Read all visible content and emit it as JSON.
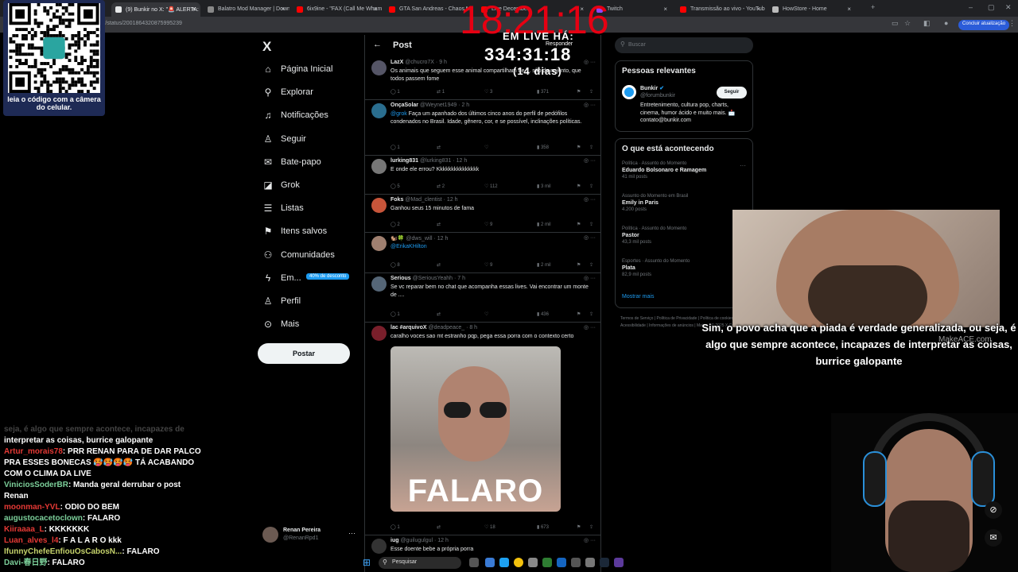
{
  "tabs": [
    {
      "title": "(9) Bunkir no X: \"🚨 ALERTA: E",
      "color": "#e7e9ea",
      "active": true
    },
    {
      "title": "Balatro Mod Manager | Downlo",
      "color": "#888"
    },
    {
      "title": "6ix9ine - \"FAX (Call Me Wham)\"",
      "color": "#ff0000"
    },
    {
      "title": "GTA San Andreas - Chaos M",
      "color": "#ff0000"
    },
    {
      "title": "Live December",
      "color": "#ff0000"
    },
    {
      "title": "Twitch",
      "color": "#9146ff"
    },
    {
      "title": "Transmissão ao vivo - YouTube",
      "color": "#ff0000"
    },
    {
      "title": "HowStore - Home",
      "color": "#bbb"
    }
  ],
  "address": {
    "url": "r/status/2001864320875995239",
    "action_button": "Concluir atualização"
  },
  "qr": {
    "caption": "leia o código com a câmera do celular."
  },
  "overlay": {
    "clock": "18:21:16",
    "live_label": "EM LIVE HÁ:",
    "live_time": "334:31:18",
    "live_days": "(14 dias)"
  },
  "sidebar": {
    "logo": "X",
    "items": [
      {
        "label": "Página Inicial",
        "icon": "home-icon",
        "glyph": "⌂"
      },
      {
        "label": "Explorar",
        "icon": "search-icon",
        "glyph": "⚲"
      },
      {
        "label": "Notificações",
        "icon": "bell-icon",
        "glyph": "♫"
      },
      {
        "label": "Seguir",
        "icon": "follow-icon",
        "glyph": "♙"
      },
      {
        "label": "Bate-papo",
        "icon": "mail-icon",
        "glyph": "✉"
      },
      {
        "label": "Grok",
        "icon": "grok-icon",
        "glyph": "◪"
      },
      {
        "label": "Listas",
        "icon": "list-icon",
        "glyph": "☰"
      },
      {
        "label": "Itens salvos",
        "icon": "bookmark-icon",
        "glyph": "⚑"
      },
      {
        "label": "Comunidades",
        "icon": "people-icon",
        "glyph": "⚇"
      },
      {
        "label": "Em...",
        "icon": "bolt-icon",
        "glyph": "ϟ"
      },
      {
        "label": "Perfil",
        "icon": "person-icon",
        "glyph": "♙"
      },
      {
        "label": "Mais",
        "icon": "more-icon",
        "glyph": "⊙"
      }
    ],
    "promo_badge": "40% de desconto",
    "post_button": "Postar",
    "profile": {
      "name": "Renan Pereira",
      "handle": "@RenanRpd1"
    }
  },
  "feed": {
    "title": "Post",
    "reply_label": "Responder",
    "tweets": [
      {
        "name": "LazX",
        "handle": "@chucro7X · 9 h",
        "text": "Os animais que seguem esse animal compartilham de ... são de nojento, que todos passem fome",
        "replies": "1",
        "reposts": "1",
        "likes": "3",
        "views": "371",
        "avatar": "#556"
      },
      {
        "name": "OnçaSolar",
        "handle": "@Weynet1949 · 2 h",
        "mention": "@grok",
        "text": " Faça um apanhado dos últimos cinco anos do perfil de pedófilos condenados no Brasil. Idade, gênero, cor, e se possível, inclinações políticas.",
        "replies": "1",
        "reposts": "",
        "likes": "",
        "views": "358",
        "avatar": "#2a6e8f"
      },
      {
        "name": "lurking831",
        "handle": "@lurking831 · 12 h",
        "text": "E onde ele errou? Kkkkkkkkkkkkkkk",
        "replies": "5",
        "reposts": "2",
        "likes": "112",
        "views": "3 mil",
        "avatar": "#777"
      },
      {
        "name": "Foks",
        "handle": "@Mad_clentist · 12 h",
        "text": "Ganhou seus 15 minutos de fama",
        "replies": "2",
        "reposts": "",
        "likes": "9",
        "views": "2 mil",
        "avatar": "#c7553a"
      },
      {
        "name": "🐿️🍀",
        "handle": "@dws_will · 12 h",
        "mention": "@ErikaKHilton",
        "text": "",
        "replies": "8",
        "reposts": "",
        "likes": "9",
        "views": "2 mil",
        "avatar": "#a08070"
      },
      {
        "name": "Serious",
        "handle": "@SeriousYeahh · 7 h",
        "text": "Se vc reparar bem no chat que acompanha essas lives. Vai encontrar um monte de ....",
        "replies": "1",
        "reposts": "",
        "likes": "",
        "views": "436",
        "avatar": "#556677"
      },
      {
        "name": "lac #arquivoX",
        "handle": "@deadpeace_ · 8 h",
        "text": "caralho voces sao mt estranho pqp, pega essa porra com o contexto certo",
        "replies": "1",
        "reposts": "",
        "likes": "18",
        "views": "673",
        "avatar": "#7a1f2b",
        "image_caption": "FALARO"
      },
      {
        "name": "iug",
        "handle": "@guilugulgul · 12 h",
        "text": "Esse doente bebe a própria porra",
        "replies": "",
        "reposts": "",
        "likes": "",
        "views": "",
        "avatar": "#333"
      }
    ]
  },
  "right": {
    "search_placeholder": "Buscar",
    "relevant_title": "Pessoas relevantes",
    "relevant": {
      "name": "Bunkir",
      "handle": "@forumbunkir",
      "follow": "Seguir",
      "bio": "Entretenimento, cultura pop, charts, cinema, humor ácido e muito mais. 📩 contato@bunkir.com"
    },
    "trending_title": "O que está acontecendo",
    "trends": [
      {
        "cat": "Política · Assunto do Momento",
        "name": "Eduardo Bolsonaro e Ramagem",
        "posts": "41 mil posts"
      },
      {
        "cat": "Assunto do Momento em Brasil",
        "name": "Emily in Paris",
        "posts": "4.200 posts"
      },
      {
        "cat": "Política · Assunto do Momento",
        "name": "Pastor",
        "posts": "43,3 mil posts"
      },
      {
        "cat": "Esportes · Assunto do Momento",
        "name": "Plata",
        "posts": "82,9 mil posts"
      }
    ],
    "show_more": "Mostrar mais",
    "legal": "Termos de Serviço | Política de Privacidade | Política de cookies | Acessibilidade | Informações de anúncios | Mais ··· © 2025 X Corp."
  },
  "subtitles": {
    "line1": "Sim, o povo acha que a piada é verdade generalizada, ou seja, é",
    "line2": "algo que sempre acontece, incapazes de interpretar as coisas,",
    "line3": "burrice galopante",
    "watermark": "MakeACE.com"
  },
  "chat": [
    {
      "user": "",
      "color": "#888",
      "msg": "seja, é algo que sempre acontece, incapazes de"
    },
    {
      "user": "",
      "color": "#fff",
      "msg": "interpretar as coisas, burrice galopante"
    },
    {
      "user": "Artur_morais78",
      "color": "#e53935",
      "msg": ": PRR RENAN PARA DE DAR PALCO PRA ESSES BONECAS 🥵🥵🥵🥵 TÁ ACABANDO COM O CLIMA DA LIVE"
    },
    {
      "user": "ViniciosSoderBR",
      "color": "#7ccf9a",
      "msg": ": Manda geral derrubar o post Renan"
    },
    {
      "user": "moonman-YVL",
      "color": "#e53935",
      "msg": ": ODIO DO BEM"
    },
    {
      "user": "augustocacetoclown",
      "color": "#7ccf9a",
      "msg": ": FALARO"
    },
    {
      "user": "Kiiraaaa_L",
      "color": "#e53935",
      "msg": ": KKKKKKK"
    },
    {
      "user": "Luan_alves_l4",
      "color": "#e53935",
      "msg": ": F A L A R O kkk"
    },
    {
      "user": "IfunnyChefeEnfiouOsCabosN...",
      "color": "#c6d36b",
      "msg": ": FALARO"
    },
    {
      "user": "Davi-春日野",
      "color": "#7ccf9a",
      "msg": ": FALARO"
    }
  ],
  "taskbar": {
    "search": "Pesquisar"
  }
}
